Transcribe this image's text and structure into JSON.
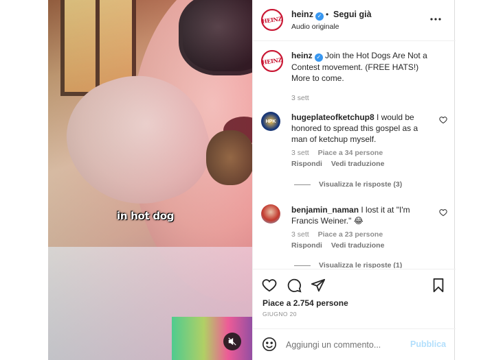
{
  "post": {
    "author": "heinz",
    "follow_status": "Segui già",
    "separator": "•",
    "audio": "Audio originale",
    "more_icon": "more-horizontal-icon",
    "logo_text": "HEINZ"
  },
  "video": {
    "caption": "in hot dog",
    "mute_icon": "speaker-muted-icon"
  },
  "caption": {
    "username": "heinz",
    "text": "Join the Hot Dogs Are Not a Contest movement. (FREE HATS!) More to come.",
    "time": "3 sett"
  },
  "comments": [
    {
      "username": "hugeplateofketchup8",
      "text": "I would be honored to spread this gospel as a man of ketchup myself.",
      "time": "3 sett",
      "likes": "Piace a 34 persone",
      "reply": "Rispondi",
      "translate": "Vedi traduzione",
      "view_replies": "Visualizza le risposte (3)"
    },
    {
      "username": "benjamin_naman",
      "text": "I lost it at \"I'm Francis Weiner.\" 😂",
      "time": "3 sett",
      "likes": "Piace a 23 persone",
      "reply": "Rispondi",
      "translate": "Vedi traduzione",
      "view_replies": "Visualizza le risposte (1)"
    }
  ],
  "actions": {
    "likes": "Piace a 2.754 persone",
    "date": "GIUGNO 20"
  },
  "composer": {
    "placeholder": "Aggiungi un commento...",
    "publish": "Pubblica"
  },
  "colors": {
    "verified": "#3897f0",
    "brand": "#c8102e",
    "publish_disabled": "#b2dffc",
    "muted_text": "#8e8e8e"
  }
}
